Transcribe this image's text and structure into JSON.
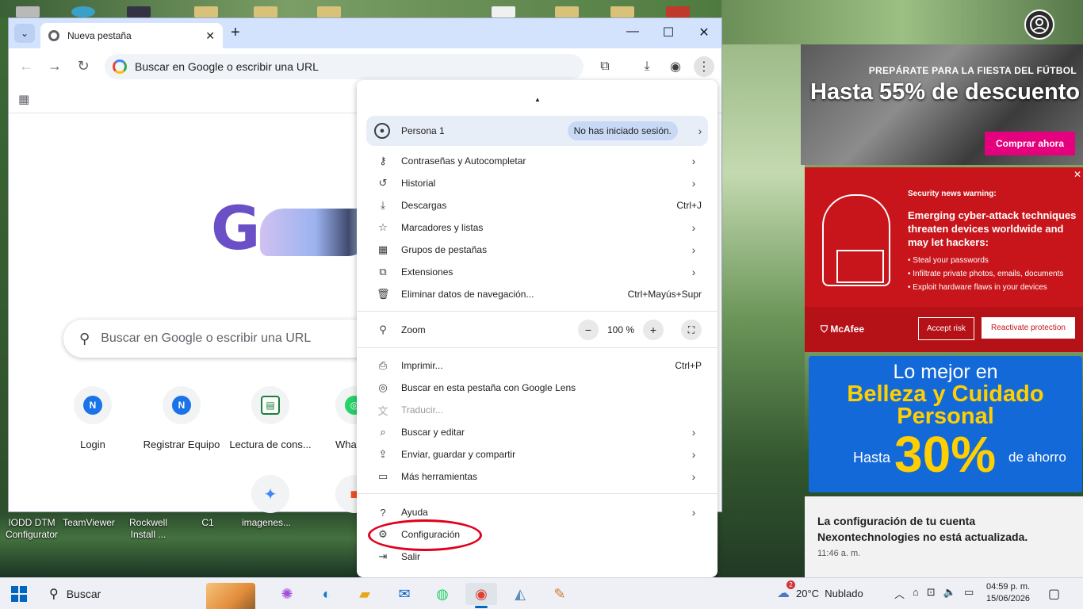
{
  "browser": {
    "tab_title": "Nueva pestaña",
    "omnibox_text": "Buscar en Google o escribir una URL",
    "ntp_search_placeholder": "Buscar en Google o escribir una URL",
    "shortcuts": [
      {
        "label": "Login",
        "initial": "N"
      },
      {
        "label": "Registrar Equipo",
        "initial": "N"
      },
      {
        "label": "Lectura de cons...",
        "initial": "▤"
      },
      {
        "label": "Wha",
        "initial": "◎"
      }
    ]
  },
  "menu": {
    "profile_name": "Persona 1",
    "profile_status": "No has iniciado sesión.",
    "items_group1": [
      {
        "label": "Contraseñas y Autocompletar",
        "icon": "key-icon",
        "shortcut": "",
        "submenu": true
      },
      {
        "label": "Historial",
        "icon": "history-icon",
        "shortcut": "",
        "submenu": true
      },
      {
        "label": "Descargas",
        "icon": "download-icon",
        "shortcut": "Ctrl+J",
        "submenu": false
      },
      {
        "label": "Marcadores y listas",
        "icon": "star-icon",
        "shortcut": "",
        "submenu": true
      },
      {
        "label": "Grupos de pestañas",
        "icon": "grid-icon",
        "shortcut": "",
        "submenu": true
      },
      {
        "label": "Extensiones",
        "icon": "puzzle-icon",
        "shortcut": "",
        "submenu": true
      },
      {
        "label": "Eliminar datos de navegación...",
        "icon": "trash-icon",
        "shortcut": "Ctrl+Mayús+Supr",
        "submenu": false
      }
    ],
    "zoom_label": "Zoom",
    "zoom_value": "100 %",
    "items_group2": [
      {
        "label": "Imprimir...",
        "shortcut": "Ctrl+P"
      },
      {
        "label": "Buscar en esta pestaña con Google Lens",
        "shortcut": ""
      },
      {
        "label": "Traducir...",
        "shortcut": ""
      },
      {
        "label": "Buscar y editar",
        "shortcut": ""
      },
      {
        "label": "Enviar, guardar y compartir",
        "shortcut": ""
      },
      {
        "label": "Más herramientas",
        "shortcut": ""
      }
    ],
    "help_label": "Ayuda",
    "settings_label": "Configuración",
    "exit_label": "Salir"
  },
  "desktop_icons": [
    {
      "label": "IODD DTM Configurator"
    },
    {
      "label": "TeamViewer"
    },
    {
      "label": "Rockwell Install ..."
    },
    {
      "label": "C1"
    },
    {
      "label": "imagenes..."
    }
  ],
  "ads": {
    "ad1_kicker": "PREPÁRATE PARA LA FIESTA DEL FÚTBOL",
    "ad1_headline": "Hasta 55% de descuento",
    "ad1_button": "Comprar ahora",
    "ad2_kicker": "Security news warning:",
    "ad2_headline": "Emerging cyber-attack techniques threaten devices worldwide and may let hackers:",
    "ad2_bullets": [
      "Steal your passwords",
      "Infiltrate private photos, emails, documents",
      "Exploit hardware flaws in your devices"
    ],
    "ad2_brand": "McAfee",
    "ad2_btn_accept": "Accept risk",
    "ad2_btn_reactivate": "Reactivate protection",
    "ad3_line1": "Lo mejor en",
    "ad3_line2": "Belleza y Cuidado",
    "ad3_line3": "Personal",
    "ad3_hasta": "Hasta",
    "ad3_percent": "30%",
    "ad3_de": "de ahorro"
  },
  "notification": {
    "text": "La configuración de tu cuenta Nexontechnologies no está actualizada.",
    "time": "11:46 a. m."
  },
  "taskbar": {
    "search_label": "Buscar",
    "weather_temp": "20°C",
    "weather_desc": "Nublado",
    "weather_badge": "2",
    "time": "04:59 p. m.",
    "date": "15/06/2026"
  },
  "colors": {
    "accent": "#0067c0",
    "highlight_ellipse": "#e1001b",
    "tabstrip": "#d3e3fd"
  }
}
